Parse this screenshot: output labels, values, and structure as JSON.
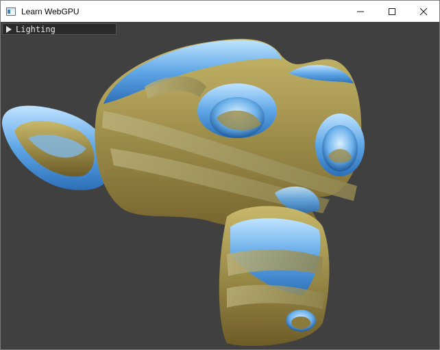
{
  "window": {
    "title": "Learn WebGPU",
    "minimize_glyph": "—",
    "maximize_glyph": "☐",
    "close_glyph": "✕",
    "icon": "app-window-icon"
  },
  "imgui": {
    "panel_label": "Lighting",
    "collapsed": true,
    "arrow_icon": "triangle-right-icon"
  },
  "scene": {
    "background_color": "#404040",
    "model": "suzanne-monkey-head"
  }
}
